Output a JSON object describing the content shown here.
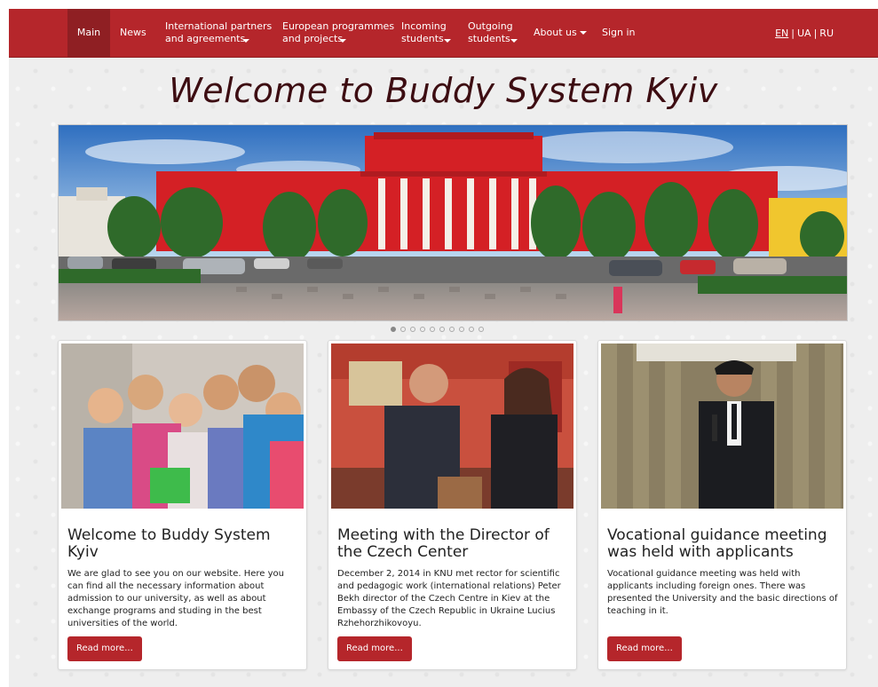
{
  "nav": {
    "items": [
      {
        "label": "Main",
        "dropdown": false,
        "active": true
      },
      {
        "label": "News",
        "dropdown": false,
        "active": false
      },
      {
        "label": "International partners\nand agreements",
        "dropdown": true,
        "active": false
      },
      {
        "label": "European programmes\nand projects",
        "dropdown": true,
        "active": false
      },
      {
        "label": "Incoming\nstudents",
        "dropdown": true,
        "active": false
      },
      {
        "label": "Outgoing\nstudents",
        "dropdown": true,
        "active": false
      },
      {
        "label": "About us",
        "dropdown": true,
        "active": false
      },
      {
        "label": "Sign in",
        "dropdown": false,
        "active": false
      }
    ],
    "languages": [
      "EN",
      "UA",
      "RU"
    ],
    "current_language": "EN"
  },
  "hero": {
    "title": "Welcome to Buddy System Kyiv"
  },
  "carousel": {
    "slide_count": 10,
    "active_index": 0
  },
  "cards": [
    {
      "title": "Welcome to Buddy System Kyiv",
      "body": "We are glad to see you on our website. Here you can find all the necessary information about admission to our university, as well as about exchange programs and studing in the best universities of the world.",
      "button": "Read more..."
    },
    {
      "title": "Meeting with the Director of the Czech Center",
      "body": "December 2, 2014 in KNU met rector for scientific and pedagogic work (international relations) Peter Bekh director of the Czech Centre in Kiev at the Embassy of the Czech Republic in Ukraine Lucius Rzhehorzhikovoyu.",
      "button": "Read more..."
    },
    {
      "title": "Vocational guidance meeting was held with applicants",
      "body": "Vocational guidance meeting was held with applicants including foreign ones. There was presented the University and the basic directions of teaching in it.",
      "button": "Read more..."
    }
  ],
  "colors": {
    "brand": "#b5262b",
    "title": "#3d0d12"
  }
}
